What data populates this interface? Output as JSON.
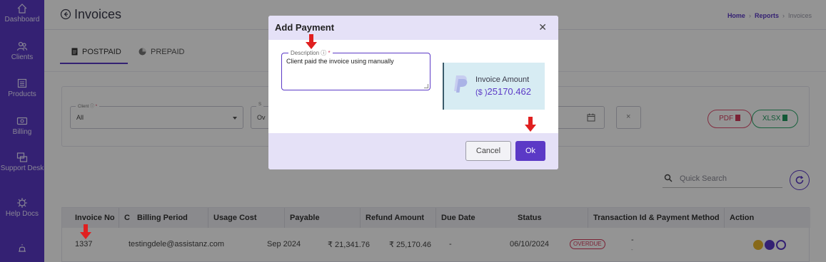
{
  "sidebar": {
    "items": [
      {
        "label": "Dashboard",
        "icon": "home-icon"
      },
      {
        "label": "Clients",
        "icon": "users-icon"
      },
      {
        "label": "Products",
        "icon": "box-icon"
      },
      {
        "label": "Billing",
        "icon": "billing-icon"
      },
      {
        "label": "Support Desk",
        "icon": "support-icon"
      },
      {
        "label": "Help Docs",
        "icon": "help-icon"
      },
      {
        "label": "",
        "icon": "bell-icon"
      }
    ]
  },
  "header": {
    "title": "Invoices",
    "breadcrumb": [
      "Home",
      "Reports",
      "Invoices"
    ]
  },
  "tabs": [
    {
      "label": "POSTPAID",
      "active": true
    },
    {
      "label": "PREPAID",
      "active": false
    }
  ],
  "filters": {
    "client_label": "Client",
    "client_value": "All",
    "second_label": "S",
    "second_value": "Ov",
    "pdf_label": "PDF",
    "xlsx_label": "XLSX"
  },
  "search": {
    "placeholder": "Quick Search"
  },
  "table": {
    "headers": [
      "Invoice No",
      "C",
      "Billing Period",
      "Usage Cost",
      "Payable",
      "Refund Amount",
      "Due Date",
      "Status",
      "Transaction Id & Payment Method",
      "Action"
    ],
    "rows": [
      {
        "invoice_no": "1337",
        "client": "testingdele@assistanz.com",
        "billing_period": "Sep 2024",
        "usage_cost": "₹ 21,341.76",
        "payable": "₹ 25,170.46",
        "refund": "-",
        "due_date": "06/10/2024",
        "status": "OVERDUE",
        "transaction": "-",
        "transaction_sub": "-"
      }
    ]
  },
  "modal": {
    "title": "Add Payment",
    "description_label": "Description",
    "description_value": "Client paid the invoice using manually",
    "amount_label": "Invoice Amount",
    "amount_currency": "($ )",
    "amount_value": "25170.462",
    "cancel_label": "Cancel",
    "ok_label": "Ok"
  },
  "colors": {
    "brand": "#5b39c6",
    "danger": "#d43b5c",
    "success": "#1f9a5f",
    "modal_band": "#e5e1f7",
    "amount_card": "#d7ecf3",
    "annotation_arrow": "#e02020"
  }
}
